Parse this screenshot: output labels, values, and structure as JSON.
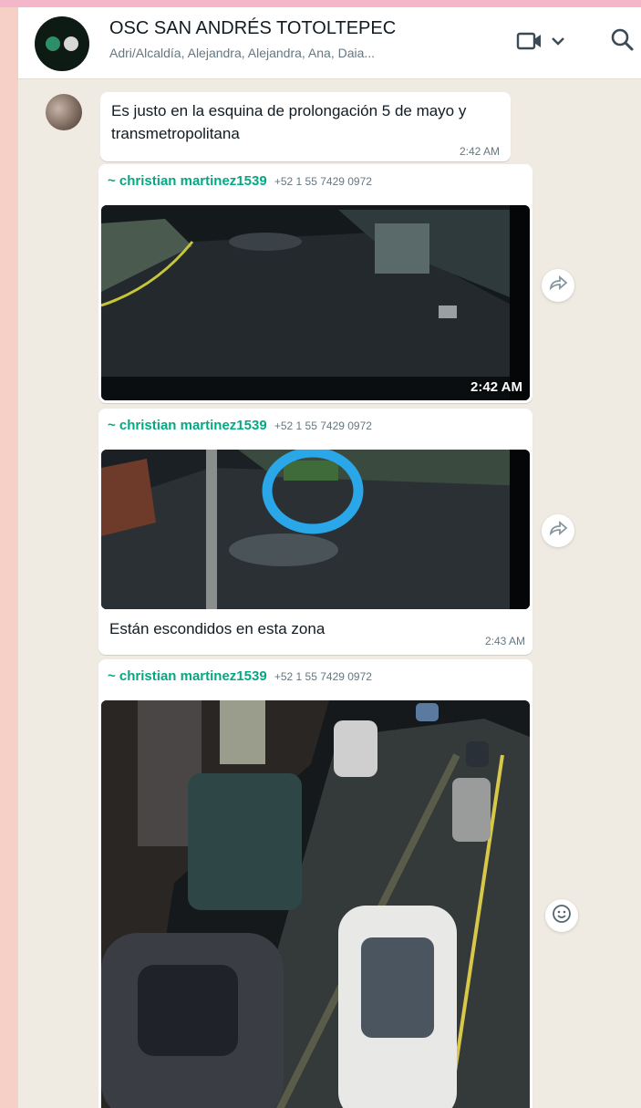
{
  "header": {
    "title": "OSC SAN ANDRÉS TOTOLTEPEC",
    "members": "Adri/Alcaldía, Alejandra, Alejandra, Ana, Daia..."
  },
  "messages": [
    {
      "text": "Es justo en la esquina de prolongación 5 de mayo y transmetropolitana",
      "time": "2:42 AM"
    },
    {
      "sender_name": "~ christian martinez1539",
      "sender_phone": "+52 1 55 7429 0972",
      "overlay_time": "2:42 AM"
    },
    {
      "sender_name": "~ christian martinez1539",
      "sender_phone": "+52 1 55 7429 0972",
      "caption": "Están escondidos en esta zona",
      "time": "2:43 AM"
    },
    {
      "sender_name": "~ christian martinez1539",
      "sender_phone": "+52 1 55 7429 0972"
    }
  ],
  "icons": {
    "video": "video-camera-icon",
    "dropdown": "chevron-down-icon",
    "search": "search-icon",
    "forward": "forward-icon",
    "emoji": "emoji-icon"
  },
  "colors": {
    "sender_name": "#06a884",
    "chat_bg": "#efeae2",
    "highlight_circle": "#2aa7e8"
  }
}
